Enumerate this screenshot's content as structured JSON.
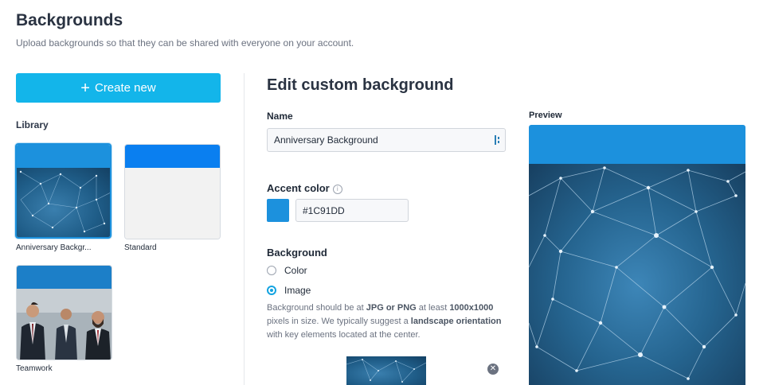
{
  "header": {
    "title": "Backgrounds",
    "subtitle": "Upload backgrounds so that they can be shared with everyone on your account."
  },
  "sidebar": {
    "create_label": "Create new",
    "library_label": "Library",
    "items": [
      {
        "label": "Anniversary Backgr...",
        "accent": "#1C91DD",
        "type": "image-network",
        "selected": true
      },
      {
        "label": "Standard",
        "accent": "#0A7FF0",
        "type": "plain-light",
        "selected": false
      },
      {
        "label": "Teamwork",
        "accent": "#1C7FC8",
        "type": "image-photo",
        "selected": false
      }
    ]
  },
  "editor": {
    "title": "Edit custom background",
    "name_label": "Name",
    "name_value": "Anniversary Background",
    "accent_label": "Accent color",
    "accent_value": "#1C91DD",
    "background_label": "Background",
    "options": [
      {
        "label": "Color",
        "selected": false
      },
      {
        "label": "Image",
        "selected": true
      }
    ],
    "help": {
      "t1": "Background should be at ",
      "b1": "JPG or PNG",
      "t2": " at least ",
      "b2": "1000x1000",
      "t3": " pixels in size. We typically suggest a ",
      "b3": "landscape orientation",
      "t4": " with key elements located at the center."
    }
  },
  "preview": {
    "label": "Preview"
  },
  "colors": {
    "accent": "#1C91DD",
    "create_button": "#13B5EA",
    "net_dark": "#134063"
  },
  "icons": [
    "plus-icon",
    "info-icon",
    "remove-icon",
    "password-manager-icon"
  ]
}
